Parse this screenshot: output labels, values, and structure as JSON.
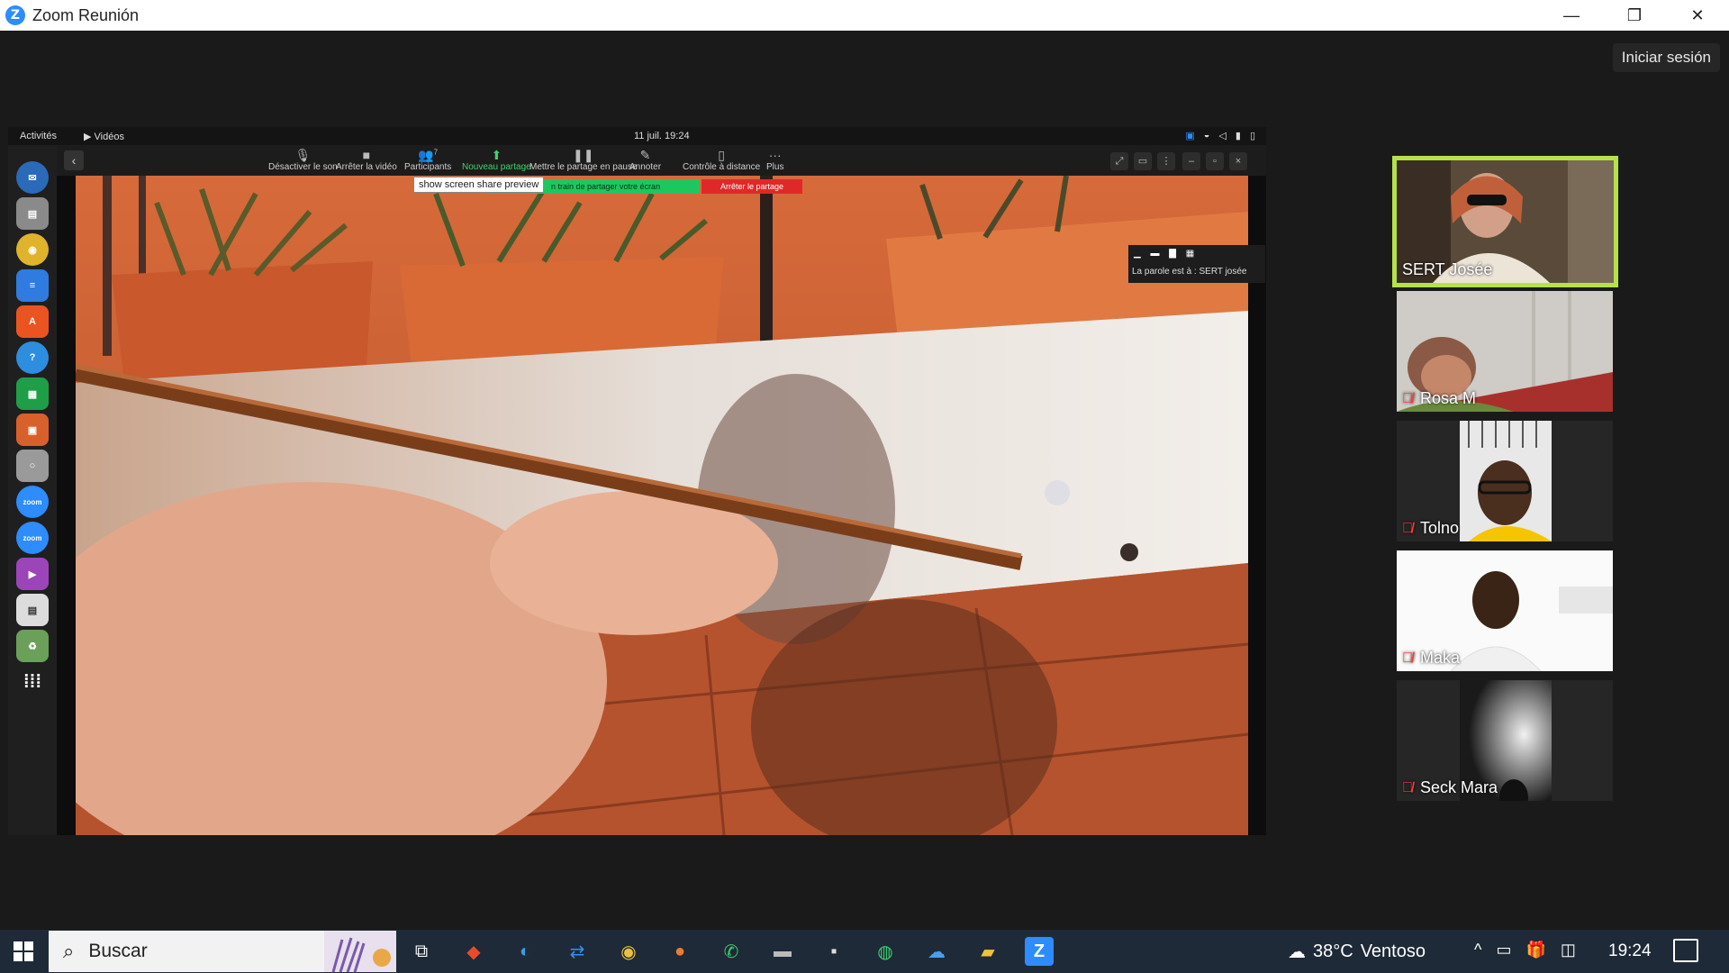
{
  "window": {
    "title": "Zoom Reunión",
    "logo": "Z",
    "controls": [
      "—",
      "❐",
      "✕"
    ]
  },
  "signin": {
    "label": "Iniciar sesión"
  },
  "shared_screen": {
    "topbar": {
      "activities": "Activités",
      "videos": "▶  Vidéos",
      "clock": "11 juil.  19:24"
    },
    "toolbar": {
      "mute": "Désactiver le son",
      "video": "Arrêter la vidéo",
      "participants": "Participants",
      "participants_count": "7",
      "new_share": "Nouveau partage",
      "pause_share": "Mettre le partage en pause",
      "annotate": "Annoter",
      "remote_control": "Contrôle à distance",
      "more": "Plus"
    },
    "tooltip": "show screen share preview",
    "sharing_banner": "n train de partager votre écran",
    "stop_share": "Arrêter le partage",
    "speaking_label": "La parole est à : SERT josée"
  },
  "participants": [
    {
      "name": "SERT Josée",
      "active": true,
      "muted": false
    },
    {
      "name": "Rosa M",
      "active": false,
      "muted": true
    },
    {
      "name": "Tolno",
      "active": false,
      "muted": true
    },
    {
      "name": "Maka",
      "active": false,
      "muted": true
    },
    {
      "name": "Seck Mara",
      "active": false,
      "muted": true
    }
  ],
  "taskbar": {
    "search_placeholder": "Buscar",
    "weather_temp": "38°C",
    "weather_desc": "Ventoso",
    "time": "19:24"
  },
  "colors": {
    "active_speaker_border": "#b5e24b",
    "zoom_blue": "#2d8cff",
    "share_green": "#1ec75e",
    "stop_red": "#e02828",
    "muted_red": "#ff3b3b"
  }
}
